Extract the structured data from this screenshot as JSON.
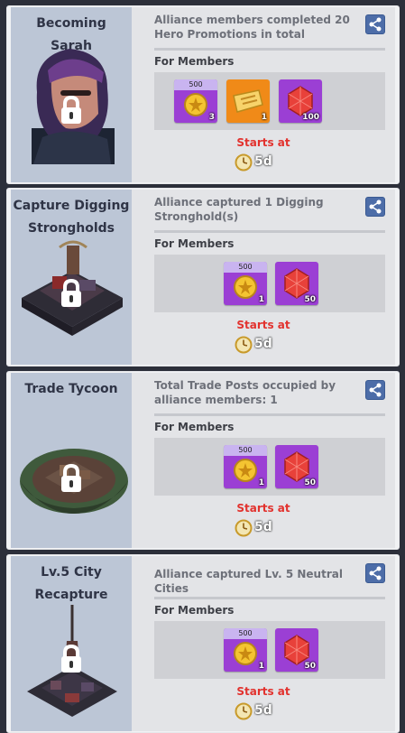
{
  "events": [
    {
      "title_line1": "Becoming",
      "title_line2": "Sarah",
      "description": "Alliance members completed 20 Hero Promotions in total",
      "for_members": "For Members",
      "rewards": [
        {
          "kind": "hero-medal",
          "badge": "500",
          "qty": "3"
        },
        {
          "kind": "gold-ticket",
          "badge": "",
          "qty": "1"
        },
        {
          "kind": "red-gem",
          "badge": "",
          "qty": "100"
        }
      ],
      "starts_at": "Starts at",
      "timer": "5d",
      "art": "hero-portrait"
    },
    {
      "title_line1": "Capture Digging",
      "title_line2": "Strongholds",
      "description": "Alliance captured 1 Digging Stronghold(s)",
      "for_members": "For Members",
      "rewards": [
        {
          "kind": "hero-medal",
          "badge": "500",
          "qty": "1"
        },
        {
          "kind": "red-gem",
          "badge": "",
          "qty": "50"
        }
      ],
      "starts_at": "Starts at",
      "timer": "5d",
      "art": "stronghold-building"
    },
    {
      "title_line1": "Trade Tycoon",
      "title_line2": "",
      "description": "Total Trade Posts occupied by alliance members: 1",
      "for_members": "For Members",
      "rewards": [
        {
          "kind": "hero-medal",
          "badge": "500",
          "qty": "1"
        },
        {
          "kind": "red-gem",
          "badge": "",
          "qty": "50"
        }
      ],
      "starts_at": "Starts at",
      "timer": "5d",
      "art": "trade-post-island"
    },
    {
      "title_line1": "Lv.5 City",
      "title_line2": "Recapture",
      "description": "Alliance captured Lv. 5 Neutral Cities",
      "for_members": "For Members",
      "rewards": [
        {
          "kind": "hero-medal",
          "badge": "500",
          "qty": "1"
        },
        {
          "kind": "red-gem",
          "badge": "",
          "qty": "50"
        }
      ],
      "starts_at": "Starts at",
      "timer": "5d",
      "art": "city-tower"
    }
  ],
  "icons": {
    "share": "share-icon",
    "lock": "lock-icon",
    "timer": "clock-icon"
  },
  "colors": {
    "starts_at_red": "#e2322e",
    "share_blue": "#4d6da8",
    "reward_purple": "#9b3fd4",
    "reward_orange": "#f08a18"
  }
}
